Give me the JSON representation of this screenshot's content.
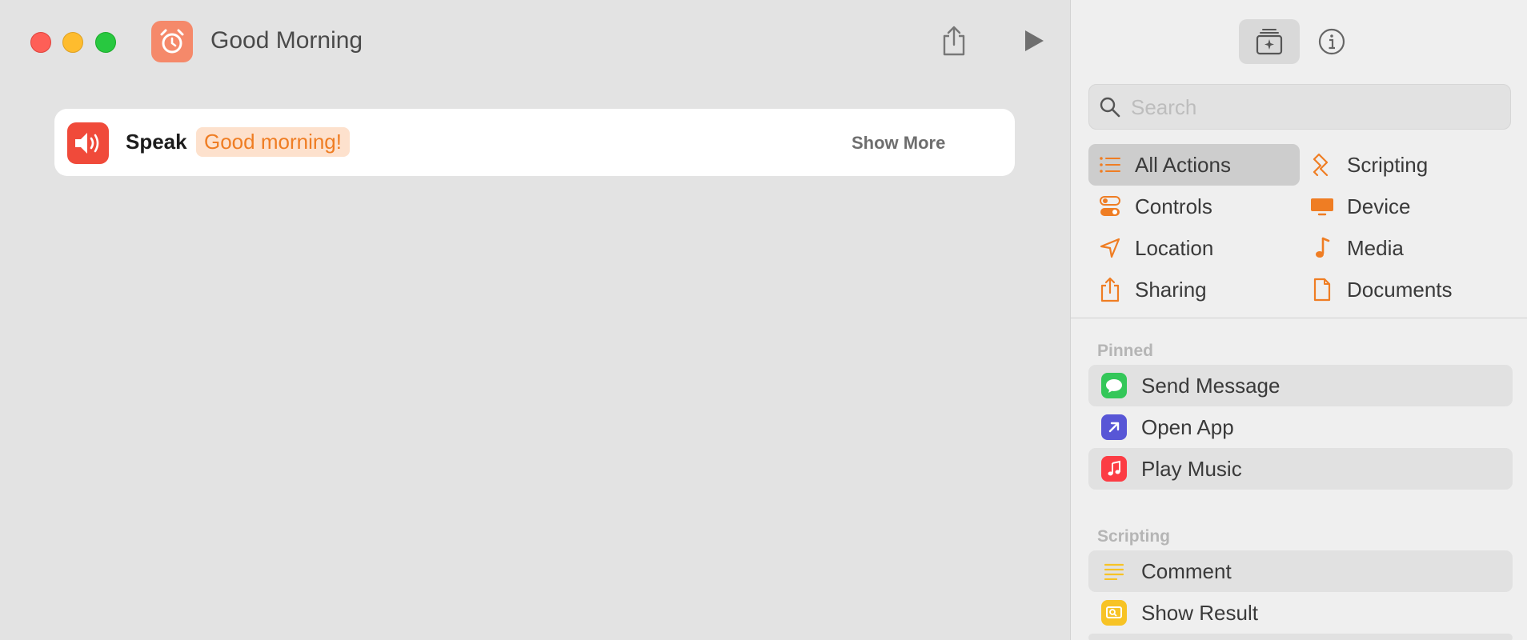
{
  "window": {
    "title": "Good Morning"
  },
  "editor": {
    "action": {
      "label": "Speak",
      "parameter": "Good morning!",
      "show_more": "Show More"
    }
  },
  "sidebar": {
    "search": {
      "placeholder": "Search",
      "value": ""
    },
    "categories": [
      {
        "label": "All Actions",
        "icon": "list-icon",
        "selected": true
      },
      {
        "label": "Scripting",
        "icon": "scripting-icon"
      },
      {
        "label": "Controls",
        "icon": "toggles-icon"
      },
      {
        "label": "Device",
        "icon": "display-icon"
      },
      {
        "label": "Location",
        "icon": "location-arrow-icon"
      },
      {
        "label": "Media",
        "icon": "music-note-icon"
      },
      {
        "label": "Sharing",
        "icon": "share-icon"
      },
      {
        "label": "Documents",
        "icon": "document-icon"
      }
    ],
    "pinned_header": "Pinned",
    "pinned": [
      {
        "label": "Send Message",
        "icon": "messages-icon",
        "color": "#34c759"
      },
      {
        "label": "Open App",
        "icon": "open-app-icon",
        "color": "#5856d6"
      },
      {
        "label": "Play Music",
        "icon": "music-icon",
        "color": "#fc3c44"
      }
    ],
    "scripting_header": "Scripting",
    "scripting": [
      {
        "label": "Comment",
        "icon": "comment-icon",
        "color": "#f7c325"
      },
      {
        "label": "Show Result",
        "icon": "show-result-icon",
        "color": "#f7c325"
      }
    ]
  },
  "colors": {
    "accent": "#ef7d23",
    "app_icon": "#f5896a",
    "speak_icon": "#f04a3a"
  }
}
